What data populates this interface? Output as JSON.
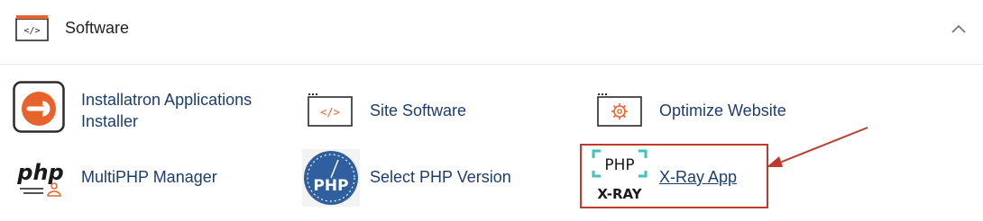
{
  "section": {
    "title": "Software",
    "icon": "code-window-icon"
  },
  "items": [
    {
      "label_line1": "Installatron Applications",
      "label_line2": "Installer",
      "icon": "installatron-icon"
    },
    {
      "label": "Site Software",
      "icon": "code-window-icon"
    },
    {
      "label": "Optimize Website",
      "icon": "gear-window-icon"
    },
    {
      "label": "MultiPHP Manager",
      "icon": "php-user-icon",
      "icon_text": "php"
    },
    {
      "label": "Select PHP Version",
      "icon": "php-gauge-icon",
      "icon_text": "PHP"
    },
    {
      "label": "X-Ray App",
      "icon": "php-xray-icon",
      "icon_text_top": "PHP",
      "icon_text_bottom": "X-RAY"
    }
  ],
  "colors": {
    "link": "#1d3d6d",
    "installatron_orange": "#e8622c",
    "highlight": "#c0392b",
    "php_blue": "#2f5f9e"
  }
}
